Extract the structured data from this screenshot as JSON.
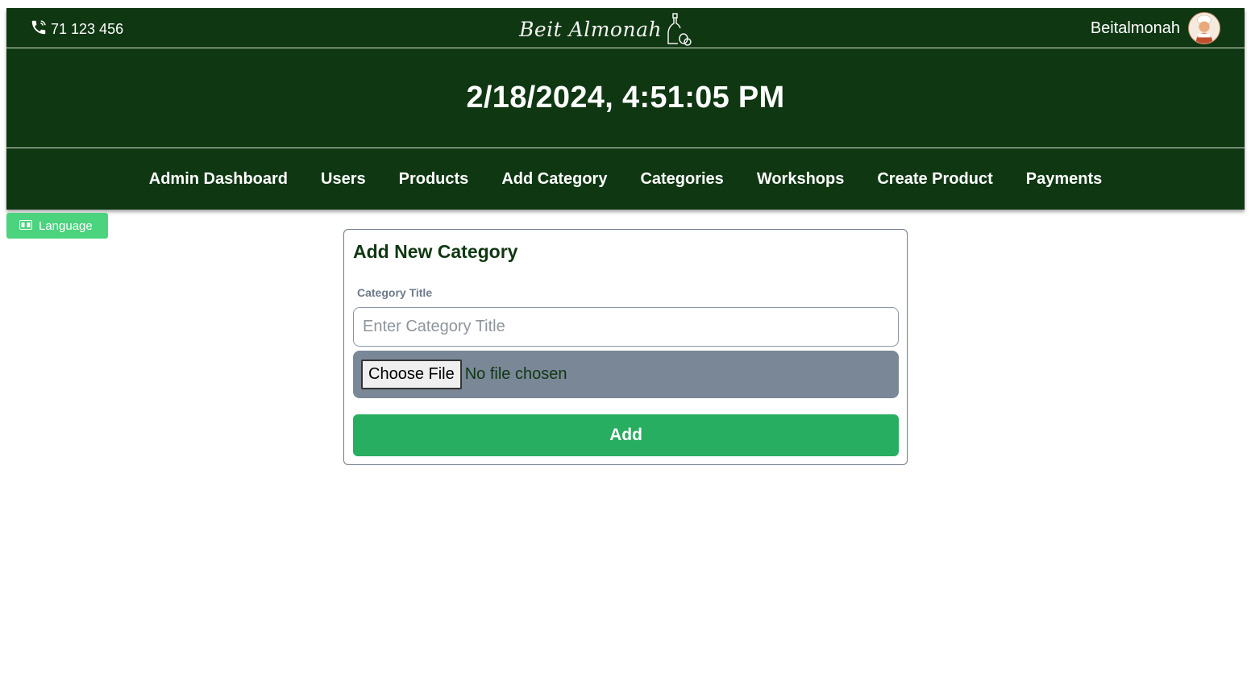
{
  "header": {
    "phone": "71 123 456",
    "brand": "Beit Almonah",
    "username": "Beitalmonah"
  },
  "clock": "2/18/2024, 4:51:05 PM",
  "nav": {
    "items": [
      {
        "label": "Admin Dashboard"
      },
      {
        "label": "Users"
      },
      {
        "label": "Products"
      },
      {
        "label": "Add Category"
      },
      {
        "label": "Categories"
      },
      {
        "label": "Workshops"
      },
      {
        "label": "Create Product"
      },
      {
        "label": "Payments"
      }
    ]
  },
  "language_button": {
    "label": "Language",
    "icon": "translate-icon",
    "color": "#4cd37e"
  },
  "form": {
    "title": "Add New Category",
    "field_label": "Category Title",
    "title_placeholder": "Enter Category Title",
    "title_value": "",
    "choose_file_label": "Choose File",
    "file_status": "No file chosen",
    "submit_label": "Add"
  },
  "colors": {
    "brand_green": "#0f3712",
    "accent_green": "#27ae60",
    "muted": "#7a8797"
  }
}
